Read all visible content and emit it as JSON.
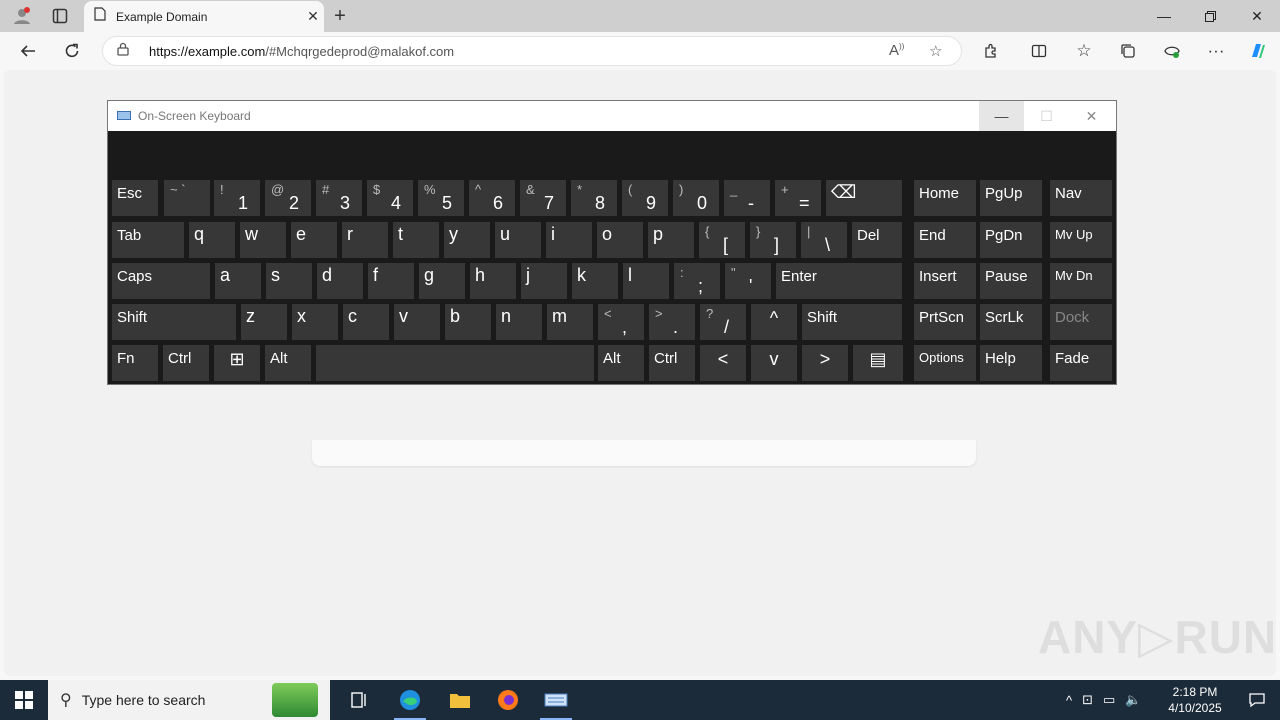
{
  "browser": {
    "tab_title": "Example Domain",
    "url_domain": "https://example.com",
    "url_rest": "/#Mchqrgedeprod@malakof.com"
  },
  "osk": {
    "title": "On-Screen Keyboard",
    "keys": [
      {
        "id": "esc",
        "label": "Esc"
      },
      {
        "id": "backquote",
        "sm": "~ `"
      },
      {
        "id": "1",
        "sm": "!",
        "mn": "1"
      },
      {
        "id": "2",
        "sm": "@",
        "mn": "2"
      },
      {
        "id": "3",
        "sm": "#",
        "mn": "3"
      },
      {
        "id": "4",
        "sm": "$",
        "mn": "4"
      },
      {
        "id": "5",
        "sm": "%",
        "mn": "5"
      },
      {
        "id": "6",
        "sm": "^",
        "mn": "6"
      },
      {
        "id": "7",
        "sm": "&",
        "mn": "7"
      },
      {
        "id": "8",
        "sm": "*",
        "mn": "8"
      },
      {
        "id": "9",
        "sm": "(",
        "mn": "9"
      },
      {
        "id": "0",
        "sm": ")",
        "mn": "0"
      },
      {
        "id": "minus",
        "sm": "_",
        "mn": "-"
      },
      {
        "id": "equals",
        "sm": "+",
        "mn": "="
      },
      {
        "id": "backspace",
        "label": "⌫"
      },
      {
        "id": "home",
        "label": "Home"
      },
      {
        "id": "pgup",
        "label": "PgUp"
      },
      {
        "id": "nav",
        "label": "Nav"
      },
      {
        "id": "tab",
        "label": "Tab"
      },
      {
        "id": "q",
        "label": "q"
      },
      {
        "id": "w",
        "label": "w"
      },
      {
        "id": "e",
        "label": "e"
      },
      {
        "id": "r",
        "label": "r"
      },
      {
        "id": "t",
        "label": "t"
      },
      {
        "id": "y",
        "label": "y"
      },
      {
        "id": "u",
        "label": "u"
      },
      {
        "id": "i",
        "label": "i"
      },
      {
        "id": "o",
        "label": "o"
      },
      {
        "id": "p",
        "label": "p"
      },
      {
        "id": "lbracket",
        "sm": "{",
        "mn": "["
      },
      {
        "id": "rbracket",
        "sm": "}",
        "mn": "]"
      },
      {
        "id": "backslash",
        "sm": "|",
        "mn": "\\"
      },
      {
        "id": "del",
        "label": "Del"
      },
      {
        "id": "end",
        "label": "End"
      },
      {
        "id": "pgdn",
        "label": "PgDn"
      },
      {
        "id": "mvup",
        "label": "Mv Up"
      },
      {
        "id": "caps",
        "label": "Caps"
      },
      {
        "id": "a",
        "label": "a"
      },
      {
        "id": "s",
        "label": "s"
      },
      {
        "id": "d",
        "label": "d"
      },
      {
        "id": "f",
        "label": "f"
      },
      {
        "id": "g",
        "label": "g"
      },
      {
        "id": "h",
        "label": "h"
      },
      {
        "id": "j",
        "label": "j"
      },
      {
        "id": "k",
        "label": "k"
      },
      {
        "id": "l",
        "label": "l"
      },
      {
        "id": "semicolon",
        "sm": ":",
        "mn": ";"
      },
      {
        "id": "quote",
        "sm": "\"",
        "mn": "'"
      },
      {
        "id": "enter",
        "label": "Enter"
      },
      {
        "id": "insert",
        "label": "Insert"
      },
      {
        "id": "pause",
        "label": "Pause"
      },
      {
        "id": "mvdn",
        "label": "Mv Dn"
      },
      {
        "id": "lshift",
        "label": "Shift"
      },
      {
        "id": "z",
        "label": "z"
      },
      {
        "id": "x",
        "label": "x"
      },
      {
        "id": "c",
        "label": "c"
      },
      {
        "id": "v",
        "label": "v"
      },
      {
        "id": "b",
        "label": "b"
      },
      {
        "id": "n",
        "label": "n"
      },
      {
        "id": "m",
        "label": "m"
      },
      {
        "id": "comma",
        "sm": "<",
        "mn": ","
      },
      {
        "id": "period",
        "sm": ">",
        "mn": "."
      },
      {
        "id": "slash",
        "sm": "?",
        "mn": "/"
      },
      {
        "id": "up",
        "label": "^"
      },
      {
        "id": "rshift",
        "label": "Shift"
      },
      {
        "id": "prtscn",
        "label": "PrtScn"
      },
      {
        "id": "scrlk",
        "label": "ScrLk"
      },
      {
        "id": "dock",
        "label": "Dock"
      },
      {
        "id": "fn",
        "label": "Fn"
      },
      {
        "id": "lctrl",
        "label": "Ctrl"
      },
      {
        "id": "win",
        "label": "⊞"
      },
      {
        "id": "lalt",
        "label": "Alt"
      },
      {
        "id": "space",
        "label": ""
      },
      {
        "id": "ralt",
        "label": "Alt"
      },
      {
        "id": "rctrl",
        "label": "Ctrl"
      },
      {
        "id": "left",
        "label": "<"
      },
      {
        "id": "down",
        "label": "v"
      },
      {
        "id": "right",
        "label": ">"
      },
      {
        "id": "menu",
        "label": "▤"
      },
      {
        "id": "options",
        "label": "Options"
      },
      {
        "id": "help",
        "label": "Help"
      },
      {
        "id": "fade",
        "label": "Fade"
      }
    ]
  },
  "watermark": "ANY▷RUN",
  "taskbar": {
    "search_placeholder": "Type here to search",
    "time": "2:18 PM",
    "date": "4/10/2025"
  }
}
